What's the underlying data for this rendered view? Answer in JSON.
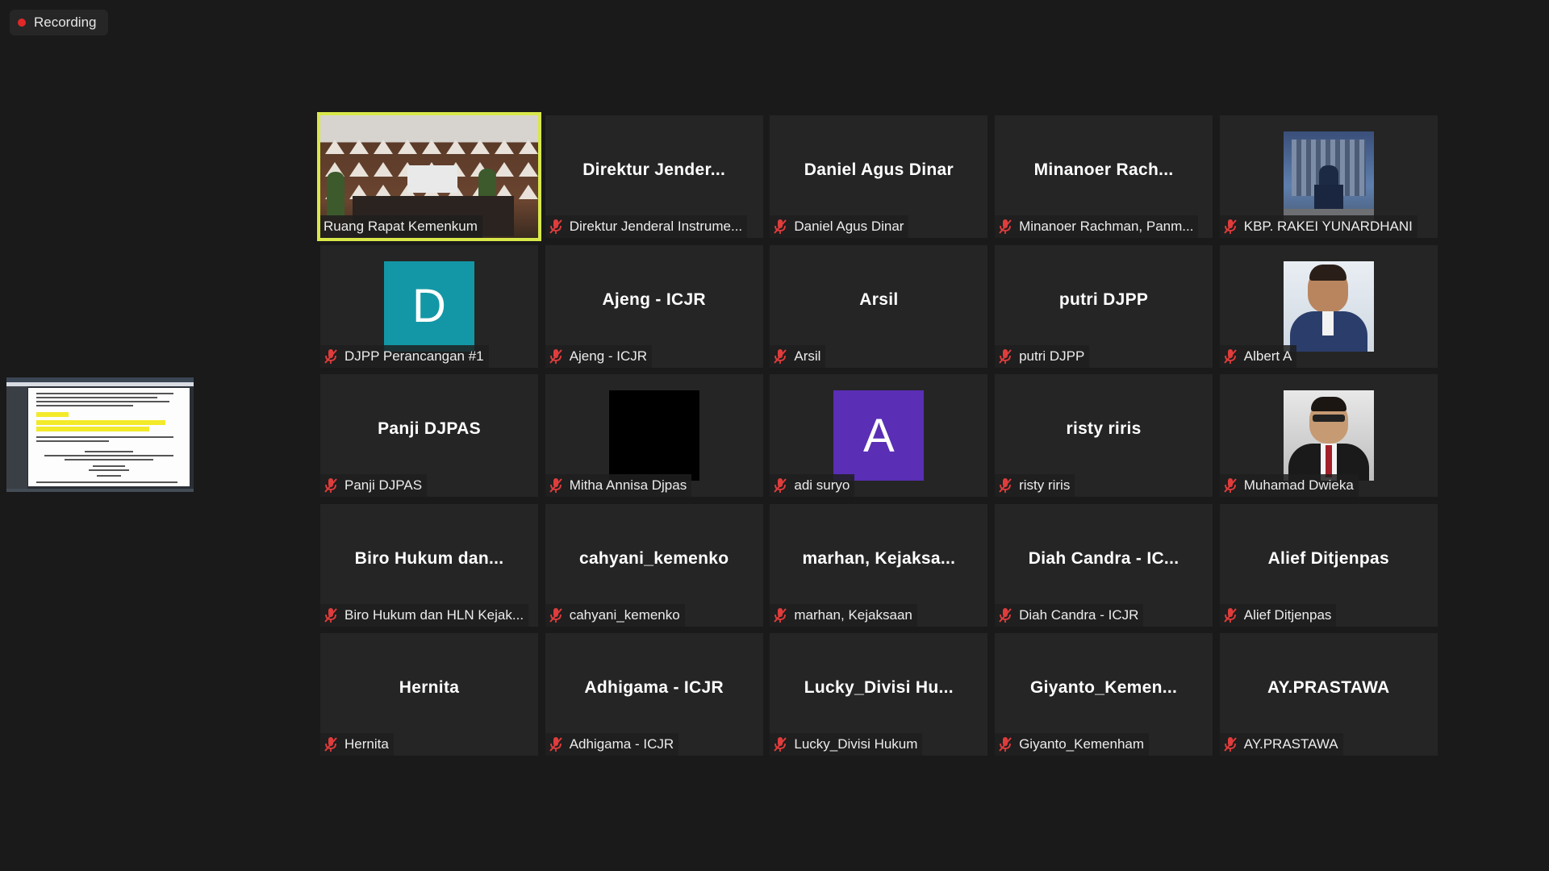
{
  "recording": {
    "label": "Recording",
    "color": "#e02828"
  },
  "colors": {
    "background": "#1a1a1a",
    "tile": "#252525",
    "active_speaker_border": "#d8e84a",
    "muted_icon": "#e03c3c"
  },
  "participants": [
    {
      "center": "",
      "label": "Ruang Rapat Kemenkum",
      "type": "video",
      "active": true
    },
    {
      "center": "Direktur  Jender...",
      "label": "Direktur Jenderal Instrume..."
    },
    {
      "center": "Daniel Agus Dinar",
      "label": "Daniel Agus Dinar"
    },
    {
      "center": "Minanoer  Rach...",
      "label": "Minanoer Rachman, Panm..."
    },
    {
      "center": "",
      "label": "KBP. RAKEI YUNARDHANI",
      "type": "photo-building"
    },
    {
      "center": "",
      "label": "DJPP Perancangan #1",
      "type": "initial",
      "initial": "D",
      "avatar_color": "#1397a6"
    },
    {
      "center": "Ajeng - ICJR",
      "label": "Ajeng - ICJR"
    },
    {
      "center": "Arsil",
      "label": "Arsil"
    },
    {
      "center": "putri DJPP",
      "label": "putri DJPP"
    },
    {
      "center": "",
      "label": "Albert A",
      "type": "photo-suit"
    },
    {
      "center": "Panji DJPAS",
      "label": "Panji DJPAS"
    },
    {
      "center": "",
      "label": "Mitha Annisa Djpas",
      "type": "black"
    },
    {
      "center": "",
      "label": "adi suryo",
      "type": "initial",
      "initial": "A",
      "avatar_color": "#5a2eb5"
    },
    {
      "center": "risty riris",
      "label": "risty riris"
    },
    {
      "center": "",
      "label": "Muhamad Dwieka",
      "type": "photo-formal"
    },
    {
      "center": "Biro  Hukum  dan...",
      "label": "Biro Hukum dan HLN Kejak..."
    },
    {
      "center": "cahyani_kemenko",
      "label": "cahyani_kemenko"
    },
    {
      "center": "marhan,  Kejaksa...",
      "label": "marhan, Kejaksaan"
    },
    {
      "center": "Diah Candra - IC...",
      "label": "Diah Candra - ICJR"
    },
    {
      "center": "Alief Ditjenpas",
      "label": "Alief Ditjenpas"
    },
    {
      "center": "Hernita",
      "label": "Hernita"
    },
    {
      "center": "Adhigama - ICJR",
      "label": "Adhigama - ICJR"
    },
    {
      "center": "Lucky_Divisi  Hu...",
      "label": "Lucky_Divisi Hukum"
    },
    {
      "center": "Giyanto_Kemen...",
      "label": "Giyanto_Kemenham"
    },
    {
      "center": "AY.PRASTAWA",
      "label": "AY.PRASTAWA"
    }
  ]
}
